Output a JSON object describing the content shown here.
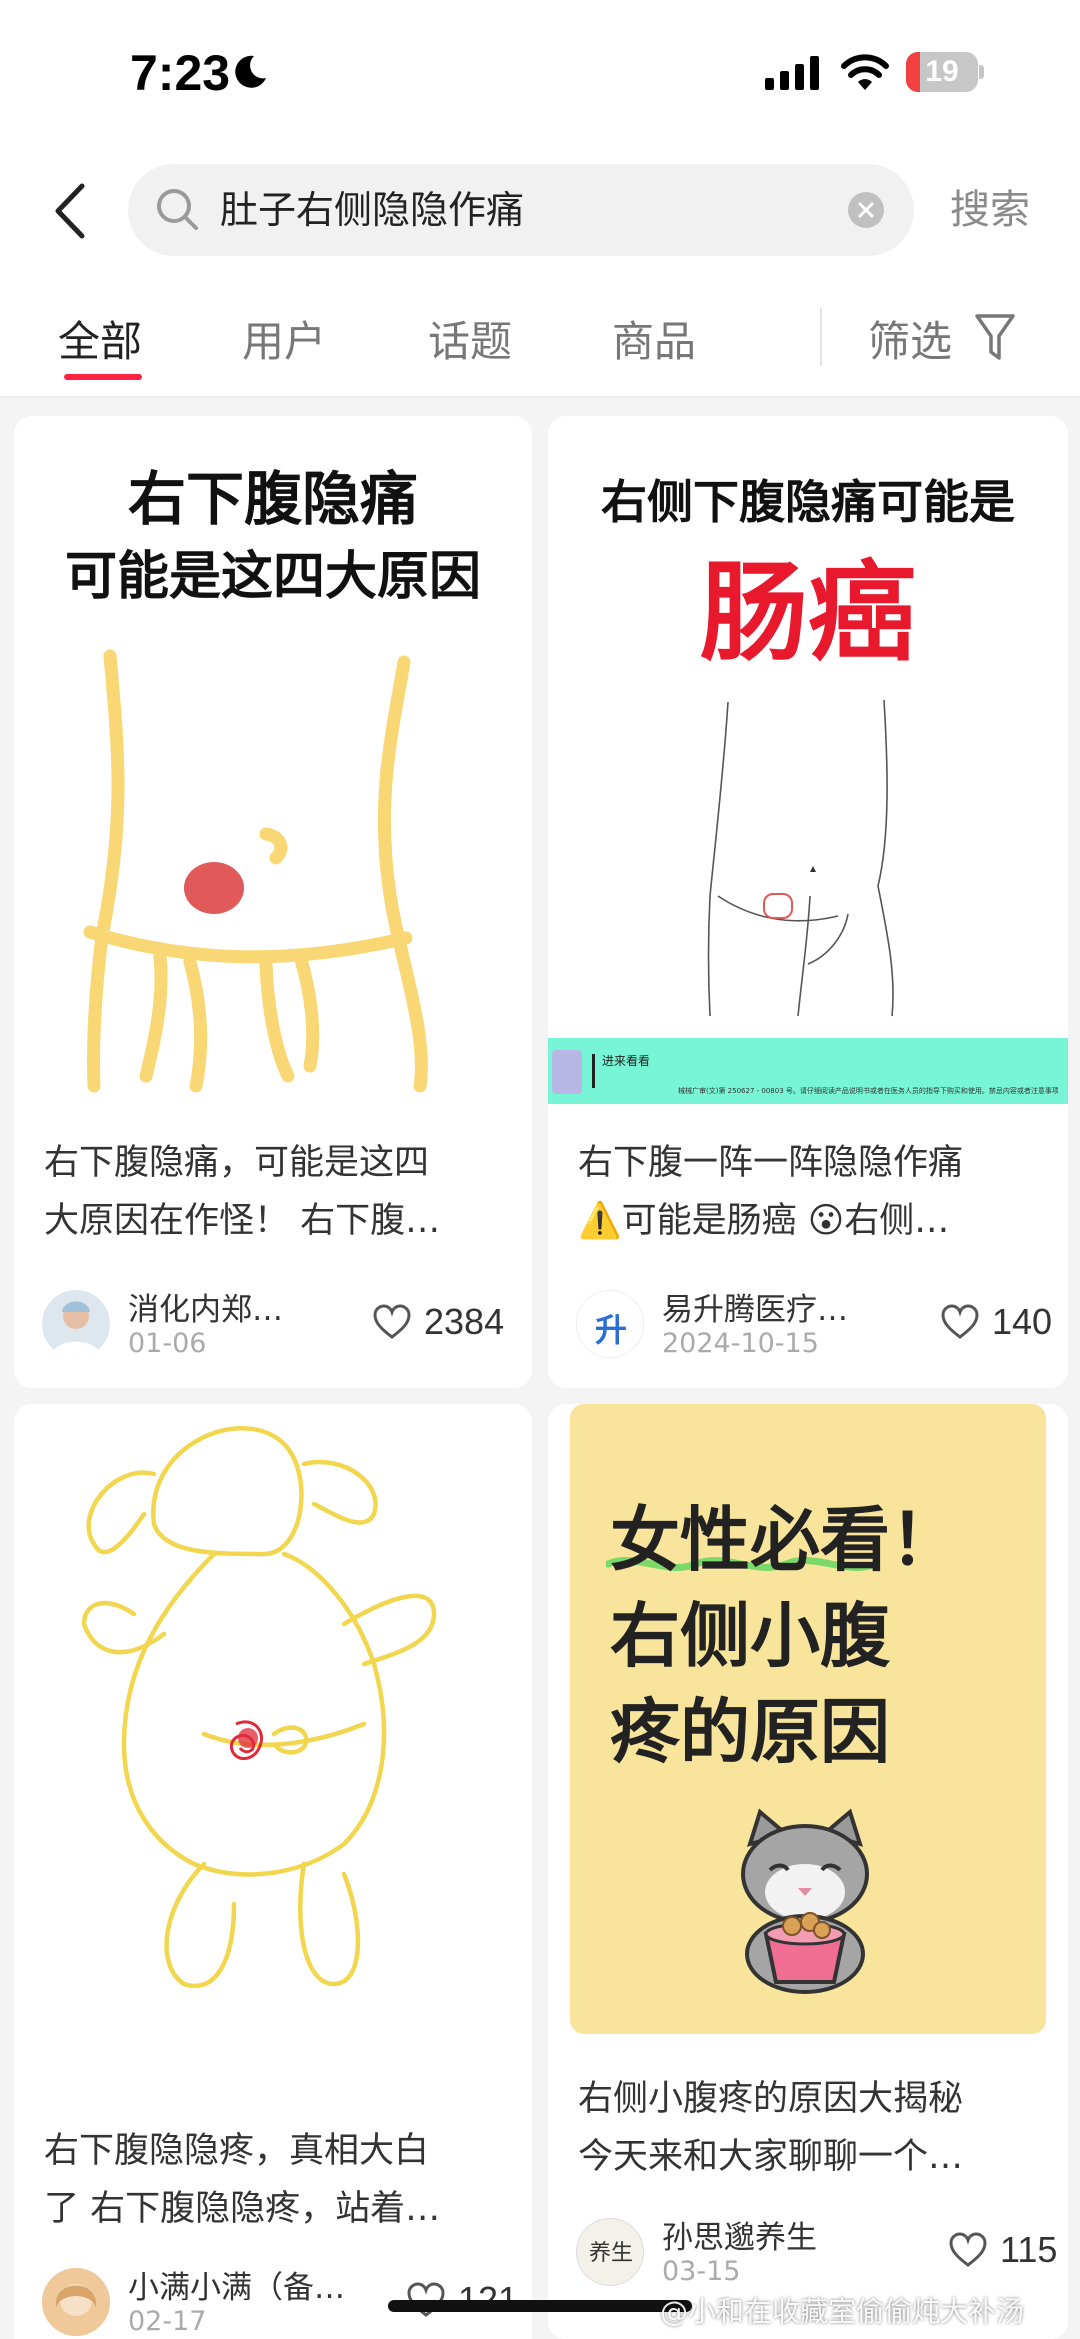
{
  "status_bar": {
    "time": "7:23",
    "battery": "19",
    "battery_level": 0.19
  },
  "search": {
    "query": "肚子右侧隐隐作痛",
    "search_button": "搜索"
  },
  "tabs": [
    {
      "label": "全部",
      "active": true
    },
    {
      "label": "用户",
      "active": false
    },
    {
      "label": "话题",
      "active": false
    },
    {
      "label": "商品",
      "active": false
    }
  ],
  "filter_label": "筛选",
  "cards": [
    {
      "image_text": [
        "右下腹隐痛",
        "可能是这四大原因"
      ],
      "title": [
        "右下腹隐痛，可能是这四",
        "大原因在作怪！ 右下腹…"
      ],
      "author": "消化内郑…",
      "date": "01-06",
      "likes": "2384"
    },
    {
      "image_text": [
        "右侧下腹隐痛可能是",
        "肠癌"
      ],
      "banner": "进来看看",
      "banner_fineprint": "械械广审(文)第 250627 - 00803 号。请仔细阅读产品说明书或者在医务人员的指导下购买和使用。禁忌内容或者注意事项详见说明书",
      "title": [
        "右下腹一阵一阵隐隐作痛",
        "⚠️可能是肠癌 😮右侧…"
      ],
      "author": "易升腾医疗…",
      "avatar_text": "升",
      "date": "2024-10-15",
      "likes": "140"
    },
    {
      "title": [
        "右下腹隐隐疼，真相大白",
        "了 右下腹隐隐疼，站着…"
      ],
      "author": "小满小满（备…",
      "date": "02-17",
      "likes": "121"
    },
    {
      "image_text": [
        "女性必看！",
        "右侧小腹",
        "疼的原因"
      ],
      "title": [
        "右侧小腹疼的原因大揭秘",
        "今天来和大家聊聊一个…"
      ],
      "author": "孙思邈养生",
      "avatar_text": "养生",
      "date": "03-15",
      "likes": "115"
    }
  ],
  "watermark": "@小和在收藏室偷偷炖大补汤",
  "colors": {
    "accent": "#ff2442",
    "sketch_yellow": "#f8d774",
    "mark_red": "#e05a5a"
  }
}
